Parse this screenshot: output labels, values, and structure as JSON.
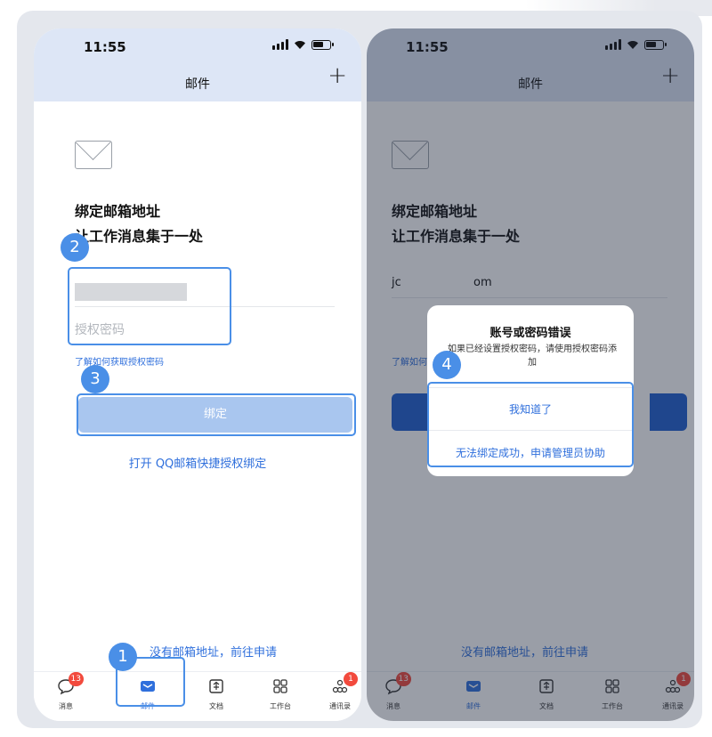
{
  "status": {
    "time": "11:55"
  },
  "nav": {
    "title": "邮件",
    "plus": "+"
  },
  "heading": {
    "line1": "绑定邮箱地址",
    "line2": "让工作消息集于一处"
  },
  "form": {
    "password_placeholder": "授权密码",
    "learn_link": "了解如何获取授权密码",
    "learn_link_cut": "了解如何",
    "bind_button": "绑定",
    "qq_link": "打开 QQ邮箱快捷授权绑定",
    "no_address_link": "没有邮箱地址，前往申请",
    "email_visible_start": "jc",
    "email_visible_end": "om"
  },
  "tabs": [
    {
      "label": "消息",
      "icon": "message-icon",
      "badge": "13"
    },
    {
      "label": "邮件",
      "icon": "mail-icon",
      "badge": ""
    },
    {
      "label": "文档",
      "icon": "document-icon",
      "badge": ""
    },
    {
      "label": "工作台",
      "icon": "workbench-icon",
      "badge": ""
    },
    {
      "label": "通讯录",
      "icon": "contacts-icon",
      "badge": "1"
    }
  ],
  "dialog": {
    "title": "账号或密码错误",
    "body": "如果已经设置授权密码，请使用授权密码添加",
    "ok_button": "我知道了",
    "help_button": "无法绑定成功，申请管理员协助"
  },
  "annotations": [
    "1",
    "2",
    "3",
    "4"
  ],
  "colors": {
    "accent": "#2f6fdc",
    "annotation": "#4a8fe7",
    "badge": "#f24a3d",
    "header": "#dde6f6"
  }
}
